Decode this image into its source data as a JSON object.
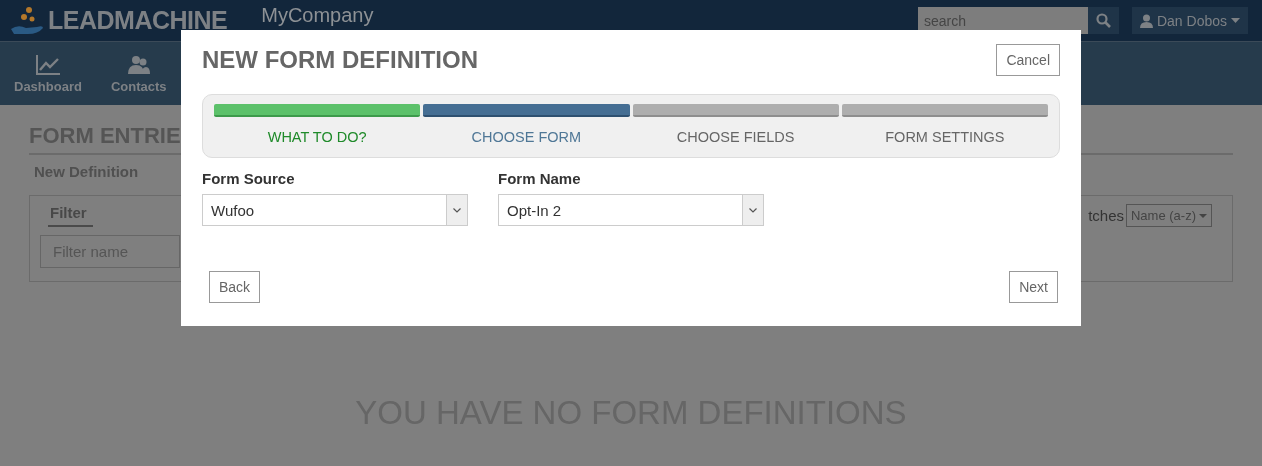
{
  "header": {
    "logo": "LEADMACHINE",
    "company": "MyCompany",
    "search": {
      "placeholder": "search"
    },
    "user": "Dan Dobos"
  },
  "nav": [
    {
      "label": "Dashboard"
    },
    {
      "label": "Contacts"
    }
  ],
  "page": {
    "title": "FORM ENTRIE",
    "action": "New Definition",
    "filter_tab": "Filter",
    "filter": {
      "placeholder": "Filter name"
    },
    "matches": "tches",
    "sort": "Name (a-z)",
    "empty": "YOU HAVE NO FORM DEFINITIONS"
  },
  "modal": {
    "title": "NEW FORM DEFINITION",
    "cancel": "Cancel",
    "steps": [
      {
        "label": "WHAT TO DO?",
        "completed": true,
        "selected": false
      },
      {
        "label": "CHOOSE FORM",
        "completed": false,
        "selected": true
      },
      {
        "label": "CHOOSE FIELDS",
        "completed": false,
        "selected": false
      },
      {
        "label": "FORM SETTINGS",
        "completed": false,
        "selected": false
      }
    ],
    "fields": [
      {
        "label": "Form Source",
        "value": "Wufoo"
      },
      {
        "label": "Form Name",
        "value": "Opt-In 2"
      }
    ],
    "back": "Back",
    "next": "Next"
  }
}
